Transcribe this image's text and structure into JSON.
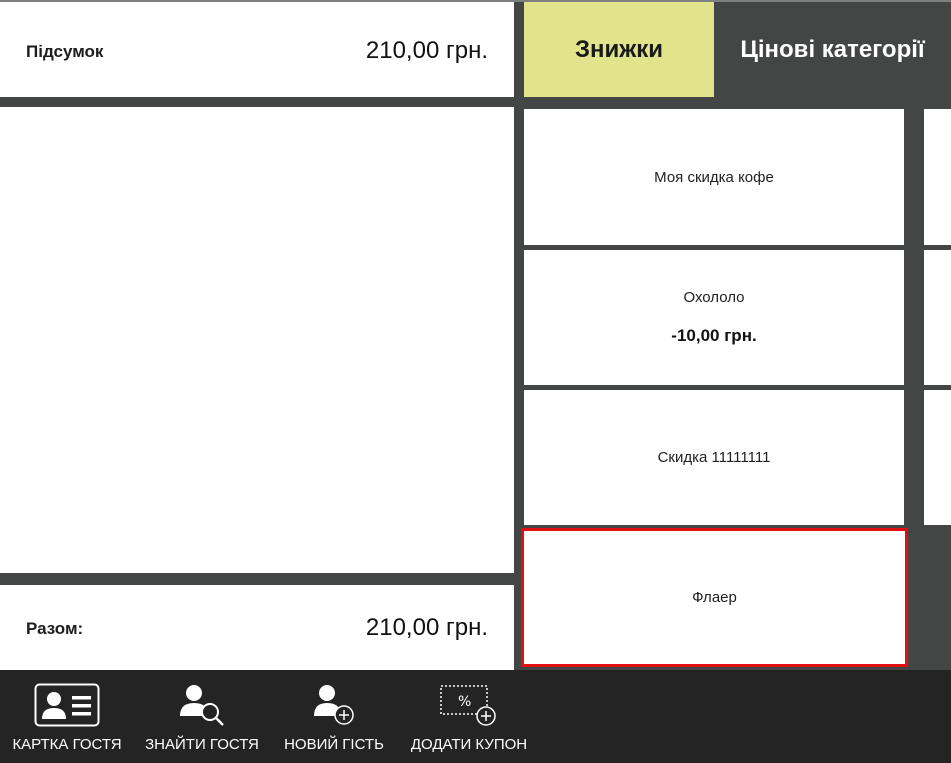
{
  "subtotal": {
    "label": "Підсумок",
    "value": "210,00 грн."
  },
  "total": {
    "label": "Разом:",
    "value": "210,00 грн."
  },
  "tabs": {
    "discounts": "Знижки",
    "price_categories": "Цінові категорії"
  },
  "discounts": [
    {
      "name": "Моя скидка кофе",
      "amount": ""
    },
    {
      "name": "Охололо",
      "amount": "-10,00 грн."
    },
    {
      "name": "Скидка 11111111",
      "amount": ""
    },
    {
      "name": "Флаер",
      "amount": ""
    }
  ],
  "bottom_bar": {
    "guest_card": "КАРТКА ГОСТЯ",
    "find_guest": "ЗНАЙТИ ГОСТЯ",
    "new_guest": "НОВИЙ ГІСТЬ",
    "add_coupon": "ДОДАТИ КУПОН"
  },
  "colors": {
    "accent_tab": "#e1e48a",
    "selected_border": "#e01010",
    "background": "#444645",
    "bottom_bar": "#242424"
  },
  "icons": [
    "guest-card-icon",
    "find-guest-icon",
    "new-guest-icon",
    "add-coupon-icon"
  ]
}
